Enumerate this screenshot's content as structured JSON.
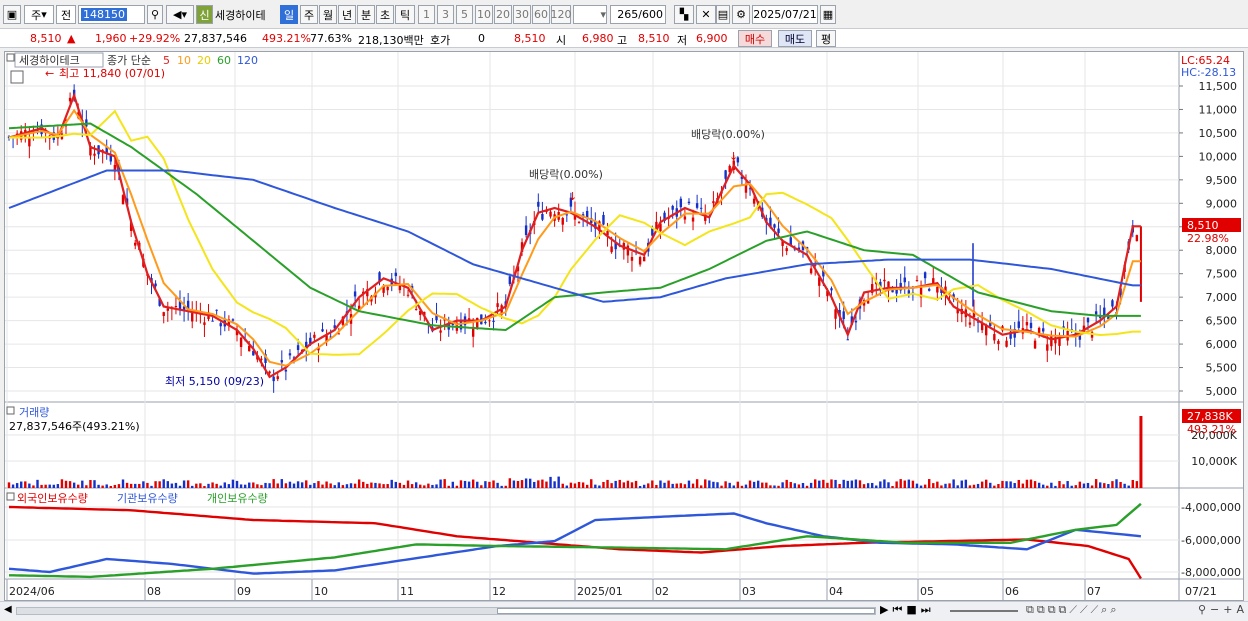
{
  "toolbar": {
    "market_select": "주",
    "type_select": "전",
    "code": "148150",
    "sin_label": "신",
    "stock_name": "세경하이테",
    "periods": [
      "일",
      "주",
      "월",
      "년",
      "분",
      "초",
      "틱"
    ],
    "active_period": "일",
    "intervals": [
      "1",
      "3",
      "5",
      "10",
      "20",
      "30",
      "60",
      "120"
    ],
    "count": "265",
    "count_total": "/600",
    "date": "2025/07/21"
  },
  "quote": {
    "price": "8,510",
    "change": "1,960",
    "change_pct": "+29.92%",
    "volume": "27,837,546",
    "volume_ratio": "493.21%",
    "turnover": "77.63%",
    "amount": "218,130백만",
    "hoga_label": "호가",
    "hoga_value": "0",
    "bid": "8,510",
    "open_label": "시",
    "open": "6,980",
    "high_label": "고",
    "high": "8,510",
    "low_label": "저",
    "low": "6,900",
    "buy_label": "매수",
    "sell_label": "매도",
    "eval_label": "평"
  },
  "price_panel": {
    "title": "세경하이테크",
    "ma_label": "종가 단순",
    "ma_periods": [
      "5",
      "10",
      "20",
      "60",
      "120"
    ],
    "ma_colors": [
      "#e02020",
      "#ff9a1a",
      "#f3e51a",
      "#2aa02a",
      "#2f57d9"
    ],
    "lc": "LC:65.24",
    "hc": "HC:-28.13",
    "high_note": "최고 11,840 (07/01)",
    "low_note": "최저 5,150 (09/23)",
    "dividend_notes": [
      "배당락(0.00%)",
      "배당락(0.00%)"
    ],
    "last_price": "8,510",
    "last_pct": "22.98%",
    "y_ticks": [
      "11,500",
      "11,000",
      "10,500",
      "10,000",
      "9,500",
      "9,000",
      "8,500",
      "8,000",
      "7,500",
      "7,000",
      "6,500",
      "6,000",
      "5,500",
      "5,000"
    ]
  },
  "volume_panel": {
    "title": "거래량",
    "value": "27,837,546주(493.21%)",
    "last": "27,838K",
    "last_pct": "493.21%",
    "y_ticks": [
      "20,000K",
      "10,000K"
    ]
  },
  "holding_panel": {
    "series": [
      "외국인보유수량",
      "기관보유수량",
      "개인보유수량"
    ],
    "colors": [
      "#e00000",
      "#2f57d9",
      "#2aa02a"
    ],
    "y_ticks": [
      "-4,000,000",
      "-6,000,000",
      "-8,000,000"
    ]
  },
  "x_axis": [
    "2024/06",
    "08",
    "09",
    "10",
    "11",
    "12",
    "2025/01",
    "02",
    "03",
    "04",
    "05",
    "06",
    "07",
    "07/21"
  ],
  "chart_data": {
    "type": "line",
    "title": "세경하이테크",
    "x": [
      "2024/06",
      "08",
      "09",
      "10",
      "11",
      "12",
      "2025/01",
      "02",
      "03",
      "04",
      "05",
      "06",
      "07",
      "07/21"
    ],
    "ylim": [
      5000,
      11800
    ],
    "series": [
      {
        "name": "5",
        "values": [
          10400,
          8600,
          5800,
          5200,
          6200,
          7200,
          6500,
          8800,
          8600,
          10000,
          8500,
          7000,
          6200,
          6800,
          6200,
          6100,
          8510
        ]
      },
      {
        "name": "120",
        "values": [
          8900,
          9700,
          9600,
          8800,
          8300,
          7300,
          6900,
          7000,
          7600,
          7800,
          7700,
          7600,
          7400,
          7200,
          7200,
          7200,
          7250
        ]
      }
    ],
    "volume_last": "27,838K"
  }
}
